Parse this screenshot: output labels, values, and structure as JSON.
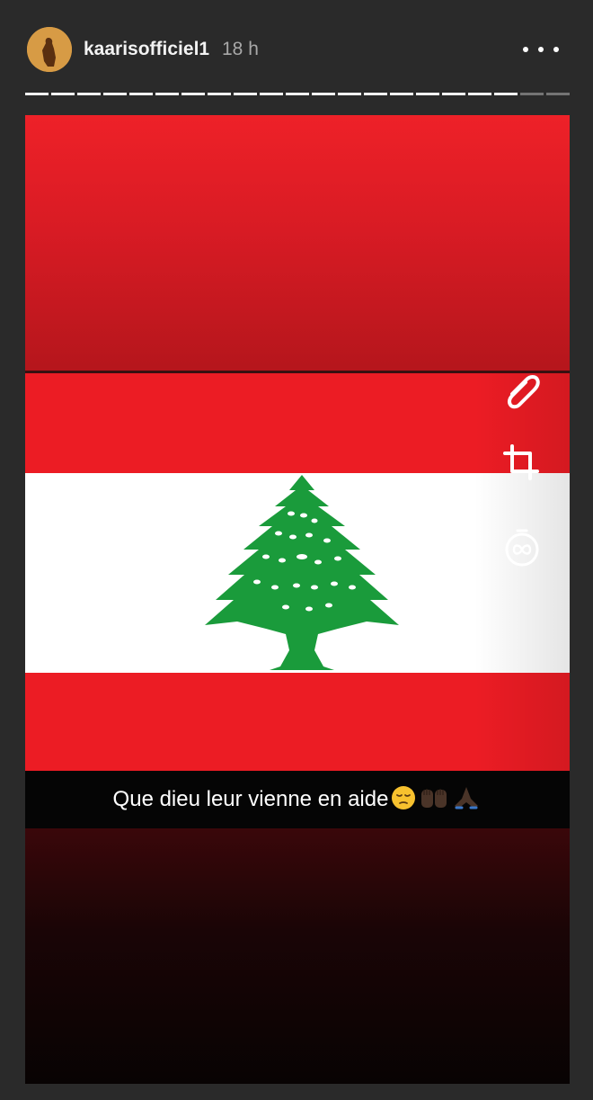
{
  "header": {
    "username": "kaarisofficiel1",
    "time_ago": "18 h",
    "more_icon": "more-horizontal-icon",
    "avatar_color": "#d79b45"
  },
  "progress": {
    "segments_total": 21,
    "segments_viewed": 19
  },
  "story": {
    "caption": "Que dieu leur vienne en aide",
    "caption_emojis": [
      "pensive-face",
      "raised-hands-dark",
      "folded-hands-dark"
    ],
    "tools": [
      "paperclip-icon",
      "crop-icon",
      "timer-icon"
    ],
    "flag_colors": {
      "red": "#ec1c24",
      "white": "#ffffff",
      "green": "#1a9b3b"
    }
  }
}
